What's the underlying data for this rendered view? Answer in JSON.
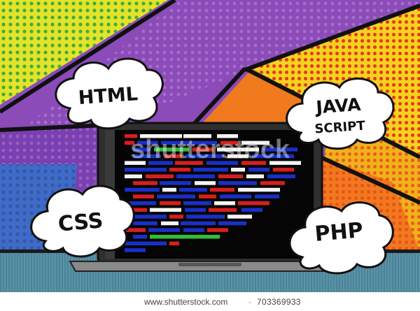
{
  "illustration": {
    "bubbles": {
      "html": "HTML",
      "css": "CSS",
      "java_line1": "JAVA",
      "java_line2": "SCRIPT",
      "php": "PHP"
    },
    "watermark": "shutterstock",
    "colors": {
      "panel_top_left": "#e9e22a",
      "panel_mid_left": "#5fc14a",
      "panel_purple": "#8b4bb8",
      "panel_orange": "#f07a1d",
      "panel_yellow_right": "#f4d21e",
      "panel_blue_left": "#4b7cd6",
      "floor": "#5a93a7",
      "laptop_frame": "#3a3a3a",
      "screen_bg": "#050505",
      "code_red": "#d91e1e",
      "code_blue": "#1a2fc8",
      "code_white": "#f5f5f5",
      "code_green": "#2fbf3a"
    }
  },
  "footer": {
    "site": "www.shutterstock.com",
    "separator": "·",
    "image_id": "703369933"
  }
}
